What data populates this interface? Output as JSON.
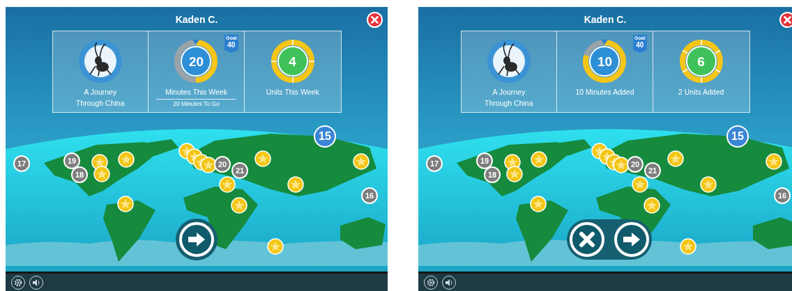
{
  "screens": [
    {
      "title": "Kaden C.",
      "book": {
        "title": "A Journey Through China"
      },
      "minutes": {
        "value": "20",
        "level": 0.5,
        "goal_label": "Goal",
        "goal_value": "40",
        "caption": "Minutes This Week",
        "subcaption": "20 Minutes To Go"
      },
      "units": {
        "value": "4",
        "caption": "Units This Week"
      },
      "pins": [
        {
          "label": "15",
          "color": "#3a86d6"
        },
        {
          "label": "17",
          "color": "#7d7d7d"
        },
        {
          "label": "19",
          "color": "#7d7d7d"
        },
        {
          "label": "20",
          "color": "#7d7d7d"
        },
        {
          "label": "21",
          "color": "#7d7d7d"
        },
        {
          "label": "18",
          "color": "#7d7d7d"
        },
        {
          "label": "16",
          "color": "#7d7d7d"
        }
      ],
      "actions": [
        {
          "kind": "next"
        }
      ]
    },
    {
      "title": "Kaden C.",
      "book": {
        "title": "A Journey Through China"
      },
      "minutes": {
        "value": "10",
        "level": 0.8,
        "goal_label": "Goal",
        "goal_value": "40",
        "caption": "10 Minutes Added"
      },
      "units": {
        "value": "6",
        "caption": "2 Units Added"
      },
      "pins": [
        {
          "label": "15",
          "color": "#3a86d6"
        },
        {
          "label": "17",
          "color": "#7d7d7d"
        },
        {
          "label": "19",
          "color": "#7d7d7d"
        },
        {
          "label": "20",
          "color": "#7d7d7d"
        },
        {
          "label": "21",
          "color": "#7d7d7d"
        },
        {
          "label": "18",
          "color": "#7d7d7d"
        },
        {
          "label": "16",
          "color": "#7d7d7d"
        }
      ],
      "actions": [
        {
          "kind": "cancel"
        },
        {
          "kind": "next"
        }
      ]
    }
  ]
}
